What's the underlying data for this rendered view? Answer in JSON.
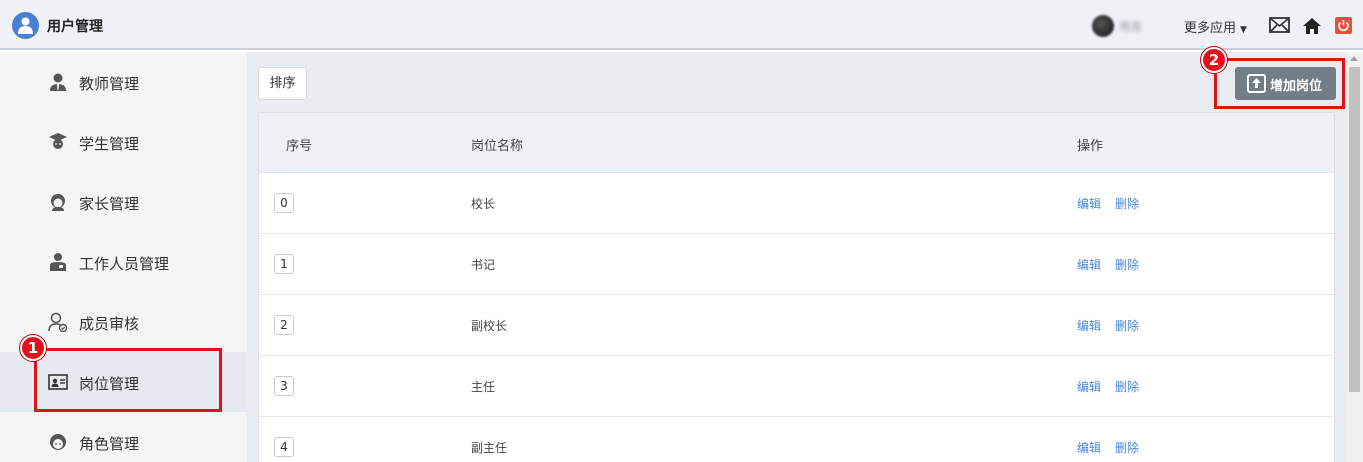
{
  "header": {
    "app_title": "用户管理",
    "user_name": "姓名",
    "more_apps": "更多应用",
    "power_color": "#e5533c"
  },
  "sidebar": {
    "items": [
      {
        "label": "教师管理",
        "icon": "teacher-icon"
      },
      {
        "label": "学生管理",
        "icon": "student-icon"
      },
      {
        "label": "家长管理",
        "icon": "parent-icon"
      },
      {
        "label": "工作人员管理",
        "icon": "staff-icon"
      },
      {
        "label": "成员审核",
        "icon": "member-review-icon"
      },
      {
        "label": "岗位管理",
        "icon": "position-card-icon",
        "active": true
      },
      {
        "label": "角色管理",
        "icon": "role-icon"
      }
    ]
  },
  "toolbar": {
    "sort_label": "排序",
    "add_label": "增加岗位"
  },
  "table": {
    "headers": [
      "序号",
      "岗位名称",
      "操作"
    ],
    "rows": [
      {
        "index": "0",
        "name": "校长",
        "edit": "编辑",
        "delete": "删除"
      },
      {
        "index": "1",
        "name": "书记",
        "edit": "编辑",
        "delete": "删除"
      },
      {
        "index": "2",
        "name": "副校长",
        "edit": "编辑",
        "delete": "删除"
      },
      {
        "index": "3",
        "name": "主任",
        "edit": "编辑",
        "delete": "删除"
      },
      {
        "index": "4",
        "name": "副主任",
        "edit": "编辑",
        "delete": "删除"
      }
    ]
  },
  "annotations": {
    "marker_1": "1",
    "marker_2": "2",
    "highlight_color": "#e0111b"
  }
}
